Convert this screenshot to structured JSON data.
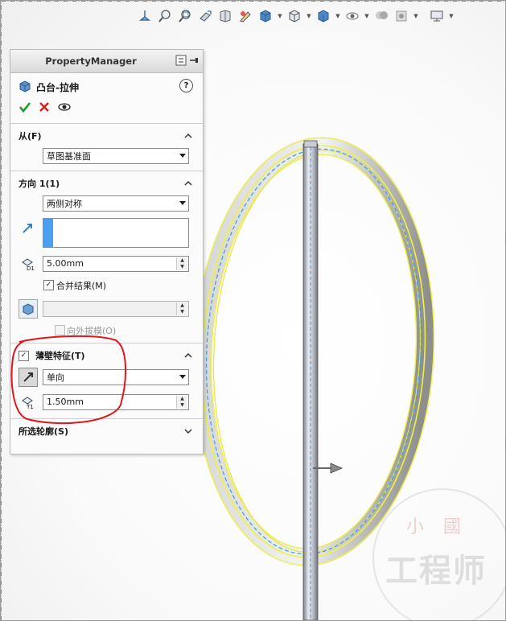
{
  "toolbar": {
    "icons": [
      "section-view-icon",
      "zoom-fit-icon",
      "zoom-area-icon",
      "previous-view-icon",
      "section-icon",
      "dynamic-annotation-icon",
      "view-orientation-icon",
      "display-style-icon",
      "hide-show-icon",
      "edit-appearance-icon",
      "apply-scene-icon",
      "view-settings-icon"
    ]
  },
  "property_manager": {
    "title": "PropertyManager",
    "feature": {
      "name": "凸台-拉伸",
      "icon": "extrude-boss-icon"
    },
    "actions": {
      "ok_icon": "checkmark-icon",
      "cancel_icon": "x-icon",
      "preview_icon": "eye-icon"
    },
    "from": {
      "label": "从(F)",
      "value": "草图基准面"
    },
    "direction1": {
      "label": "方向 1(1)",
      "end_condition": "两侧对称",
      "depth": "5.00mm",
      "merge_result_label": "合并结果(M)",
      "merge_result_checked": true,
      "draft_label": "向外拔模(O)",
      "draft_checked": false,
      "draft_value": ""
    },
    "thin_feature": {
      "label": "薄壁特征(T)",
      "checked": true,
      "type": "单向",
      "thickness": "1.50mm"
    },
    "selected_contours": {
      "label": "所选轮廓(S)"
    }
  },
  "colors": {
    "accent": "#4c9ff0",
    "highlight": "#f2f25a",
    "annotation": "#e0161b",
    "check": "#1f9d22",
    "cancel": "#d8201a"
  },
  "watermark": {
    "top": "小國",
    "main": "工程师"
  }
}
